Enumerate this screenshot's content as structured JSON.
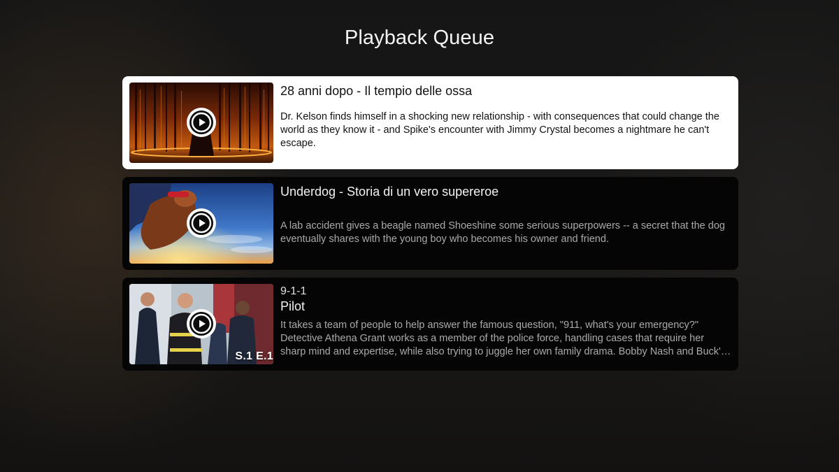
{
  "header": {
    "title": "Playback Queue"
  },
  "queue": [
    {
      "title": "28 anni dopo - Il tempio delle ossa",
      "description": "Dr. Kelson finds himself in a shocking new relationship - with consequences that could change the world as they know it - and Spike's encounter with Jimmy Crystal becomes a nightmare he can't escape.",
      "focused": true,
      "play_icon": "play-circle-icon"
    },
    {
      "title": "Underdog - Storia di un vero supereroe",
      "description": "A lab accident gives a beagle named Shoeshine some serious superpowers -- a secret that the dog eventually shares with the young boy who becomes his owner and friend.",
      "focused": false,
      "play_icon": "play-circle-icon"
    },
    {
      "series": "9-1-1",
      "title": "Pilot",
      "episode_badge": "S.1 E.1",
      "description": "It takes a team of people to help answer the famous question, \"911, what's your emergency?\" Detective Athena Grant works as a member of the police force, handling cases that require her sharp mind and expertise, while also trying to juggle her own family drama. Bobby Nash and Buck's relationship grows.",
      "focused": false,
      "play_icon": "play-circle-icon"
    }
  ],
  "colors": {
    "focused_card": "#ffffff",
    "card": "#050505",
    "title_text": "#f5f5f5",
    "muted_text": "#aaaaaa"
  }
}
